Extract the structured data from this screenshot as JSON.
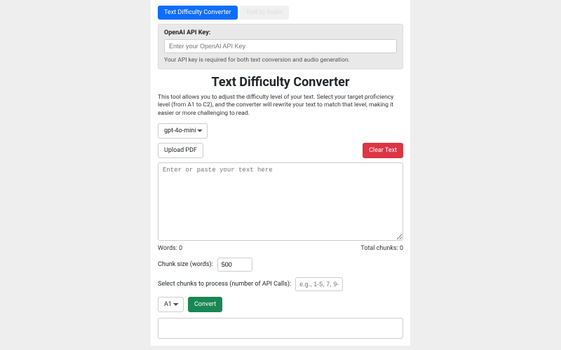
{
  "tabs": {
    "active": "Text Difficulty Converter",
    "inactive": "Text to Audio"
  },
  "api": {
    "label": "OpenAI API Key:",
    "placeholder": "Enter your OpenAI API Key",
    "note": "Your API key is required for both text conversion and audio generation."
  },
  "main": {
    "title": "Text Difficulty Converter",
    "description": "This tool allows you to adjust the difficulty level of your text. Select your target proficiency level (from A1 to C2), and the converter will rewrite your text to match that level, making it easier or more challenging to read.",
    "model_selected": "gpt-4o-mini",
    "upload_label": "Upload PDF",
    "clear_label": "Clear Text",
    "textarea_placeholder": "Enter or paste your text here",
    "word_count": "Words: 0",
    "chunk_count": "Total chunks: 0",
    "chunk_label": "Chunk size (words):",
    "chunk_value": "500",
    "select_chunks_label": "Select chunks to process (number of API Calls):",
    "select_chunks_placeholder": "e.g., 1-5, 7, 9-",
    "level_selected": "A1",
    "convert_label": "Convert"
  }
}
